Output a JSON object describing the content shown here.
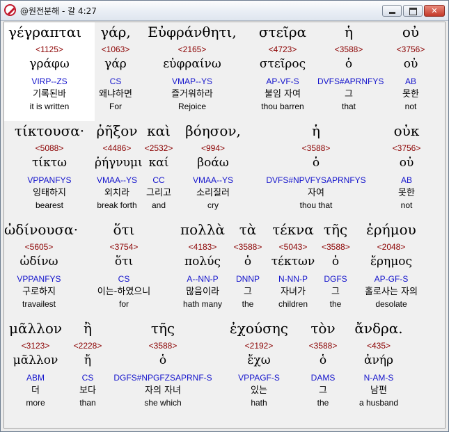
{
  "window": {
    "title": "@원전분해 - 갈 4:27"
  },
  "lines": [
    [
      {
        "greek": "γέγραπται",
        "strong": "<1125>",
        "lemma": "γράφω",
        "morph": "VIRP--ZS",
        "korean": "기록된바",
        "english": "it is written"
      },
      {
        "greek": "γάρ,",
        "strong": "<1063>",
        "lemma": "γάρ",
        "morph": "CS",
        "korean": "왜냐하면",
        "english": "For"
      },
      {
        "greek": "Εὐφράνθητι,",
        "strong": "<2165>",
        "lemma": "εὐφραίνω",
        "morph": "VMAP--YS",
        "korean": "즐거워하라",
        "english": "Rejoice"
      },
      {
        "greek": "στεῖρα",
        "strong": "<4723>",
        "lemma": "στεῖρος",
        "morph": "AP-VF-S",
        "korean": "불임 자여",
        "english": "thou barren"
      },
      {
        "greek": "ἡ",
        "strong": "<3588>",
        "lemma": "ὁ",
        "morph": "DVFS#APRNFYS",
        "korean": "그",
        "english": "that"
      },
      {
        "greek": "οὐ",
        "strong": "<3756>",
        "lemma": "οὐ",
        "morph": "AB",
        "korean": "못한",
        "english": "not"
      }
    ],
    [
      {
        "greek": "τίκτουσα·",
        "strong": "<5088>",
        "lemma": "τίκτω",
        "morph": "VPPANFYS",
        "korean": "잉태하지",
        "english": "bearest"
      },
      {
        "greek": "ῥῆξον",
        "strong": "<4486>",
        "lemma": "ῥήγνυμι",
        "morph": "VMAA--YS",
        "korean": "외치라",
        "english": "break forth"
      },
      {
        "greek": "καὶ",
        "strong": "<2532>",
        "lemma": "καί",
        "morph": "CC",
        "korean": "그리고",
        "english": "and"
      },
      {
        "greek": "βόησον,",
        "strong": "<994>",
        "lemma": "βοάω",
        "morph": "VMAA--YS",
        "korean": "소리질러",
        "english": "cry"
      },
      {
        "greek": "ἡ",
        "strong": "<3588>",
        "lemma": "ὁ",
        "morph": "DVFS#NPVFYSAPRNFYS",
        "korean": "자여",
        "english": "thou that"
      },
      {
        "greek": "οὐκ",
        "strong": "<3756>",
        "lemma": "οὐ",
        "morph": "AB",
        "korean": "못한",
        "english": "not"
      }
    ],
    [
      {
        "greek": "ὠδίνουσα·",
        "strong": "<5605>",
        "lemma": "ὠδίνω",
        "morph": "VPPANFYS",
        "korean": "구로하지",
        "english": "travailest"
      },
      {
        "greek": "ὅτι",
        "strong": "<3754>",
        "lemma": "ὅτι",
        "morph": "CS",
        "korean": "이는-하였으니",
        "english": "for"
      },
      {
        "greek": "πολλὰ",
        "strong": "<4183>",
        "lemma": "πολύς",
        "morph": "A--NN-P",
        "korean": "많음이라",
        "english": "hath many"
      },
      {
        "greek": "τὰ",
        "strong": "<3588>",
        "lemma": "ὁ",
        "morph": "DNNP",
        "korean": "그",
        "english": "the"
      },
      {
        "greek": "τέκνα",
        "strong": "<5043>",
        "lemma": "τέκτων",
        "morph": "N-NN-P",
        "korean": "자녀가",
        "english": "children"
      },
      {
        "greek": "τῆς",
        "strong": "<3588>",
        "lemma": "ὁ",
        "morph": "DGFS",
        "korean": "그",
        "english": "the"
      },
      {
        "greek": "ἐρήμου",
        "strong": "<2048>",
        "lemma": "ἔρημος",
        "morph": "AP-GF-S",
        "korean": "홀로사는 자의",
        "english": "desolate"
      }
    ],
    [
      {
        "greek": "μᾶλλον",
        "strong": "<3123>",
        "lemma": "μᾶλλον",
        "morph": "ABM",
        "korean": "더",
        "english": "more"
      },
      {
        "greek": "ἢ",
        "strong": "<2228>",
        "lemma": "ἤ",
        "morph": "CS",
        "korean": "보다",
        "english": "than"
      },
      {
        "greek": "τῆς",
        "strong": "<3588>",
        "lemma": "ὁ",
        "morph": "DGFS#NPGFZSAPRNF-S",
        "korean": "자의 자녀",
        "english": "she which"
      },
      {
        "greek": "ἐχούσης",
        "strong": "<2192>",
        "lemma": "ἔχω",
        "morph": "VPPAGF-S",
        "korean": "있는",
        "english": "hath"
      },
      {
        "greek": "τὸν",
        "strong": "<3588>",
        "lemma": "ὁ",
        "morph": "DAMS",
        "korean": "그",
        "english": "the"
      },
      {
        "greek": "ἄνδρα.",
        "strong": "<435>",
        "lemma": "ἀνήρ",
        "morph": "N-AM-S",
        "korean": "남편",
        "english": "a husband"
      }
    ]
  ]
}
